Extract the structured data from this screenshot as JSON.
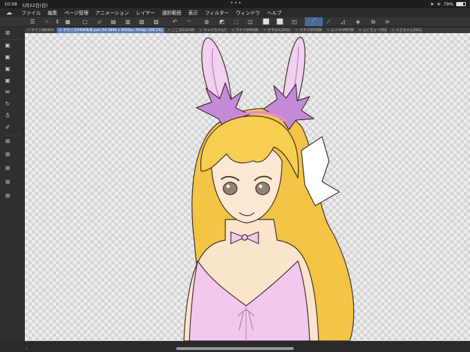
{
  "status_bar": {
    "time": "10:58",
    "date": "5月22日(日)",
    "dots": "•••",
    "battery_percent": "79%",
    "battery_level": 0.79
  },
  "menu": {
    "items": [
      "ファイル",
      "編集",
      "ページ管理",
      "アニメーション",
      "レイヤー",
      "選択範囲",
      "表示",
      "フィルター",
      "ウィンドウ",
      "ヘルプ"
    ]
  },
  "tabs": [
    {
      "label": "サイン目0424",
      "active": false
    },
    {
      "label": "そのっち0408未来.psd (A4 2894 x 4093px 350dpi 108.2%)",
      "active": true
    },
    {
      "label": "ここね0324目",
      "active": false
    },
    {
      "label": "キャルちゃんC",
      "active": false
    },
    {
      "label": "カナメ0405目",
      "active": false
    },
    {
      "label": "かすみん1011",
      "active": false
    },
    {
      "label": "マキナ0516目",
      "active": false
    },
    {
      "label": "ムツキ0407目",
      "active": false
    },
    {
      "label": "ふくちょー032",
      "active": false
    },
    {
      "label": "ぐらちゃん0321",
      "active": false
    }
  ],
  "icons": {
    "logo": "cloud-logo-icon",
    "toolbar": [
      "menu-icon",
      "brush-icon",
      "spin-icon",
      "grid-icon",
      "new-icon",
      "open-icon",
      "save-icon",
      "export-icon",
      "copy-icon",
      "paste-icon",
      "undo-icon",
      "redo-icon",
      "fill-icon",
      "clear-icon",
      "crop-icon",
      "lasso-icon",
      "wand-icon",
      "mask-icon",
      "vector-icon",
      "pen-active-icon",
      "smooth-icon",
      "ruler-icon",
      "layer-icon",
      "link-icon",
      "flip-icon"
    ],
    "left": [
      "delete-icon",
      "folder-icon",
      "folder-icon",
      "folder-icon",
      "folder-icon",
      "mail-icon",
      "reload-icon",
      "bulb-icon",
      "brush-icon",
      "delete-icon",
      "delete-icon",
      "delete-icon",
      "delete-icon"
    ]
  },
  "colors": {
    "accent": "#5a7fb0",
    "hair": "#f6cf52",
    "dress": "#f2c9ec",
    "skin": "#fbe4cc"
  }
}
